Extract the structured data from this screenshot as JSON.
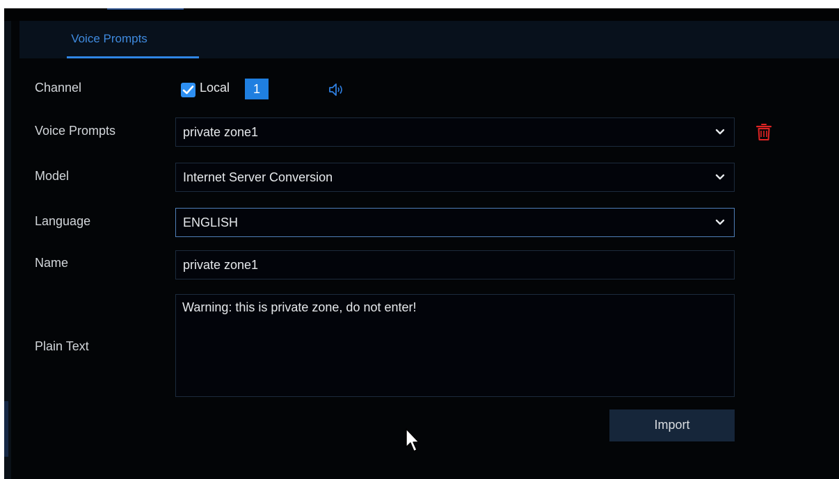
{
  "tabs": [
    {
      "label": "Voice Prompts",
      "active": true
    }
  ],
  "form": {
    "channel": {
      "label": "Channel",
      "checkbox_checked": true,
      "checkbox_label": "Local",
      "selected_channel": "1"
    },
    "voice_prompts": {
      "label": "Voice Prompts",
      "value": "private zone1"
    },
    "model": {
      "label": "Model",
      "value": "Internet Server Conversion"
    },
    "language": {
      "label": "Language",
      "value": "ENGLISH"
    },
    "name": {
      "label": "Name",
      "value": "private zone1"
    },
    "plain_text": {
      "label": "Plain Text",
      "value": "Warning: this is private zone, do not enter!"
    }
  },
  "buttons": {
    "import_label": "Import"
  },
  "icons": {
    "speaker": "speaker-icon",
    "delete": "trash-icon",
    "dropdown": "chevron-down-icon",
    "checkbox": "checkmark-icon",
    "cursor": "mouse-pointer-icon"
  },
  "colors": {
    "accent_blue": "#2f86e6",
    "tab_text": "#3f8be0",
    "delete_red": "#e02424",
    "background": "#030507"
  }
}
